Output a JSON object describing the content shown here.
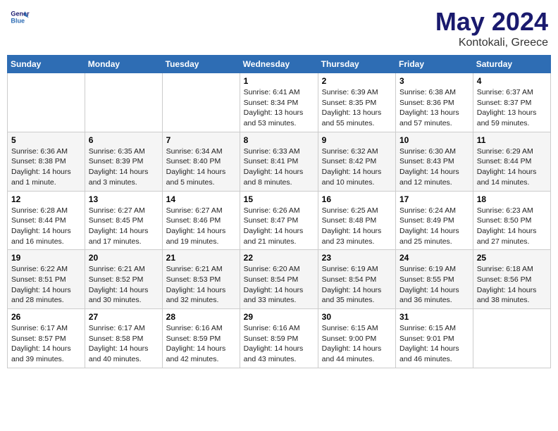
{
  "header": {
    "logo_line1": "General",
    "logo_line2": "Blue",
    "month": "May 2024",
    "location": "Kontokali, Greece"
  },
  "weekdays": [
    "Sunday",
    "Monday",
    "Tuesday",
    "Wednesday",
    "Thursday",
    "Friday",
    "Saturday"
  ],
  "weeks": [
    [
      {
        "day": "",
        "info": ""
      },
      {
        "day": "",
        "info": ""
      },
      {
        "day": "",
        "info": ""
      },
      {
        "day": "1",
        "info": "Sunrise: 6:41 AM\nSunset: 8:34 PM\nDaylight: 13 hours\nand 53 minutes."
      },
      {
        "day": "2",
        "info": "Sunrise: 6:39 AM\nSunset: 8:35 PM\nDaylight: 13 hours\nand 55 minutes."
      },
      {
        "day": "3",
        "info": "Sunrise: 6:38 AM\nSunset: 8:36 PM\nDaylight: 13 hours\nand 57 minutes."
      },
      {
        "day": "4",
        "info": "Sunrise: 6:37 AM\nSunset: 8:37 PM\nDaylight: 13 hours\nand 59 minutes."
      }
    ],
    [
      {
        "day": "5",
        "info": "Sunrise: 6:36 AM\nSunset: 8:38 PM\nDaylight: 14 hours\nand 1 minute."
      },
      {
        "day": "6",
        "info": "Sunrise: 6:35 AM\nSunset: 8:39 PM\nDaylight: 14 hours\nand 3 minutes."
      },
      {
        "day": "7",
        "info": "Sunrise: 6:34 AM\nSunset: 8:40 PM\nDaylight: 14 hours\nand 5 minutes."
      },
      {
        "day": "8",
        "info": "Sunrise: 6:33 AM\nSunset: 8:41 PM\nDaylight: 14 hours\nand 8 minutes."
      },
      {
        "day": "9",
        "info": "Sunrise: 6:32 AM\nSunset: 8:42 PM\nDaylight: 14 hours\nand 10 minutes."
      },
      {
        "day": "10",
        "info": "Sunrise: 6:30 AM\nSunset: 8:43 PM\nDaylight: 14 hours\nand 12 minutes."
      },
      {
        "day": "11",
        "info": "Sunrise: 6:29 AM\nSunset: 8:44 PM\nDaylight: 14 hours\nand 14 minutes."
      }
    ],
    [
      {
        "day": "12",
        "info": "Sunrise: 6:28 AM\nSunset: 8:44 PM\nDaylight: 14 hours\nand 16 minutes."
      },
      {
        "day": "13",
        "info": "Sunrise: 6:27 AM\nSunset: 8:45 PM\nDaylight: 14 hours\nand 17 minutes."
      },
      {
        "day": "14",
        "info": "Sunrise: 6:27 AM\nSunset: 8:46 PM\nDaylight: 14 hours\nand 19 minutes."
      },
      {
        "day": "15",
        "info": "Sunrise: 6:26 AM\nSunset: 8:47 PM\nDaylight: 14 hours\nand 21 minutes."
      },
      {
        "day": "16",
        "info": "Sunrise: 6:25 AM\nSunset: 8:48 PM\nDaylight: 14 hours\nand 23 minutes."
      },
      {
        "day": "17",
        "info": "Sunrise: 6:24 AM\nSunset: 8:49 PM\nDaylight: 14 hours\nand 25 minutes."
      },
      {
        "day": "18",
        "info": "Sunrise: 6:23 AM\nSunset: 8:50 PM\nDaylight: 14 hours\nand 27 minutes."
      }
    ],
    [
      {
        "day": "19",
        "info": "Sunrise: 6:22 AM\nSunset: 8:51 PM\nDaylight: 14 hours\nand 28 minutes."
      },
      {
        "day": "20",
        "info": "Sunrise: 6:21 AM\nSunset: 8:52 PM\nDaylight: 14 hours\nand 30 minutes."
      },
      {
        "day": "21",
        "info": "Sunrise: 6:21 AM\nSunset: 8:53 PM\nDaylight: 14 hours\nand 32 minutes."
      },
      {
        "day": "22",
        "info": "Sunrise: 6:20 AM\nSunset: 8:54 PM\nDaylight: 14 hours\nand 33 minutes."
      },
      {
        "day": "23",
        "info": "Sunrise: 6:19 AM\nSunset: 8:54 PM\nDaylight: 14 hours\nand 35 minutes."
      },
      {
        "day": "24",
        "info": "Sunrise: 6:19 AM\nSunset: 8:55 PM\nDaylight: 14 hours\nand 36 minutes."
      },
      {
        "day": "25",
        "info": "Sunrise: 6:18 AM\nSunset: 8:56 PM\nDaylight: 14 hours\nand 38 minutes."
      }
    ],
    [
      {
        "day": "26",
        "info": "Sunrise: 6:17 AM\nSunset: 8:57 PM\nDaylight: 14 hours\nand 39 minutes."
      },
      {
        "day": "27",
        "info": "Sunrise: 6:17 AM\nSunset: 8:58 PM\nDaylight: 14 hours\nand 40 minutes."
      },
      {
        "day": "28",
        "info": "Sunrise: 6:16 AM\nSunset: 8:59 PM\nDaylight: 14 hours\nand 42 minutes."
      },
      {
        "day": "29",
        "info": "Sunrise: 6:16 AM\nSunset: 8:59 PM\nDaylight: 14 hours\nand 43 minutes."
      },
      {
        "day": "30",
        "info": "Sunrise: 6:15 AM\nSunset: 9:00 PM\nDaylight: 14 hours\nand 44 minutes."
      },
      {
        "day": "31",
        "info": "Sunrise: 6:15 AM\nSunset: 9:01 PM\nDaylight: 14 hours\nand 46 minutes."
      },
      {
        "day": "",
        "info": ""
      }
    ]
  ]
}
